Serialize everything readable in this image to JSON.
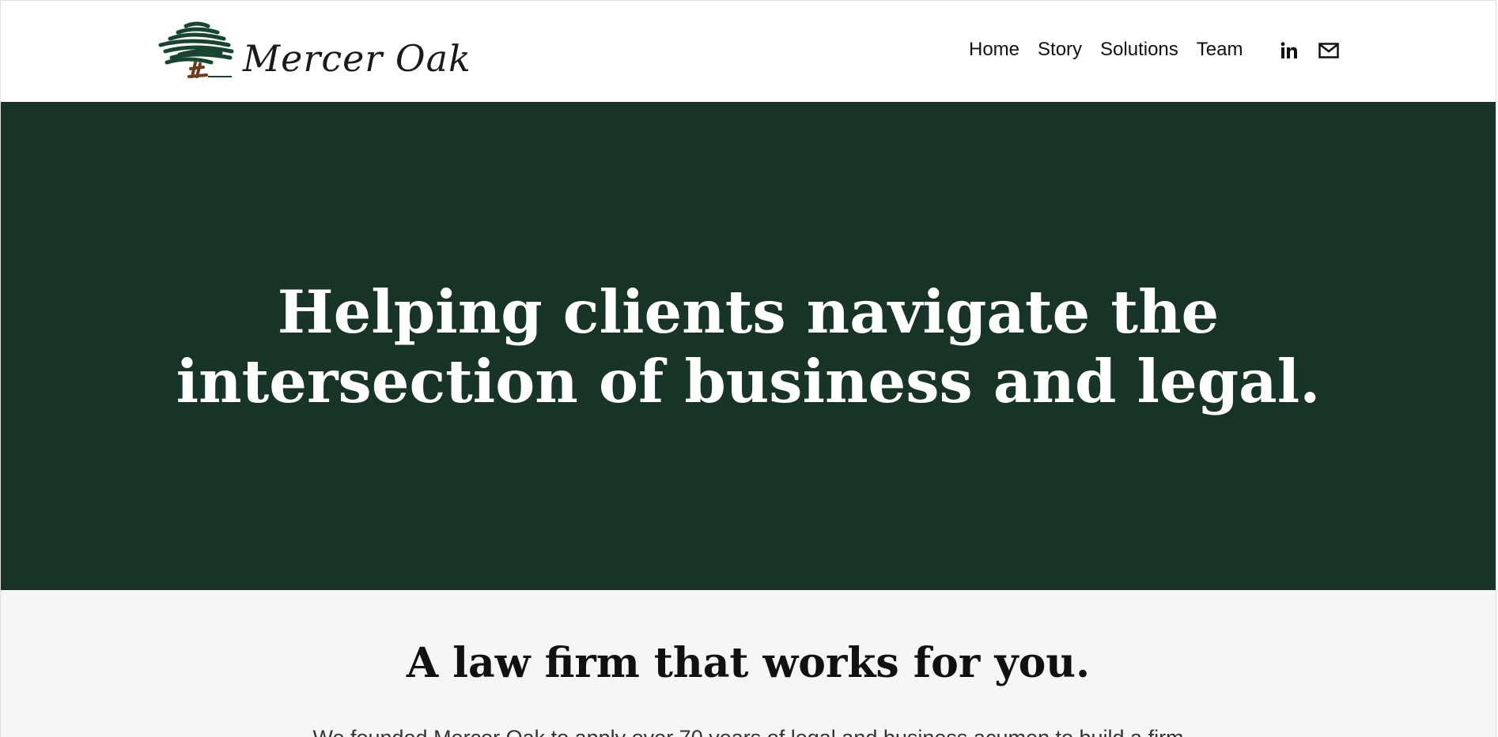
{
  "brand": {
    "name": "Mercer Oak",
    "logo_icon": "oak-tree-icon",
    "colors": {
      "canopy": "#17452f",
      "trunk": "#6b3d1f",
      "hero_bg": "#173427",
      "section_bg": "#f6f6f6"
    }
  },
  "nav": {
    "items": [
      {
        "label": "Home"
      },
      {
        "label": "Story"
      },
      {
        "label": "Solutions"
      },
      {
        "label": "Team"
      }
    ]
  },
  "social": {
    "linkedin_icon": "linkedin-icon",
    "email_icon": "email-icon"
  },
  "hero": {
    "heading_line1": "Helping clients navigate the",
    "heading_line2": "intersection of business and legal."
  },
  "intro": {
    "heading": "A law firm that works for you.",
    "body": "We founded Mercer Oak to apply over 70 years of legal and business acumen to build a firm"
  }
}
